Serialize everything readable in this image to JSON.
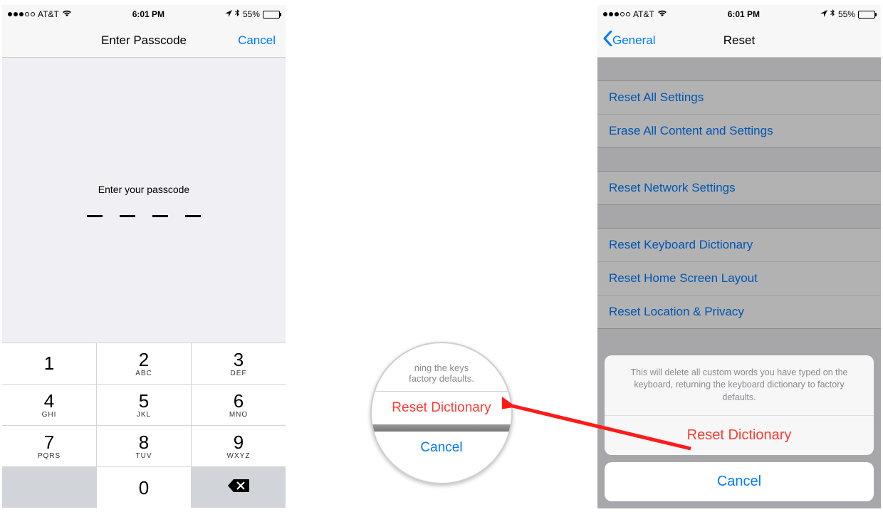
{
  "status_bar": {
    "carrier": "AT&T",
    "time": "6:01 PM",
    "battery_pct": "55%"
  },
  "passcode_screen": {
    "nav_title": "Enter Passcode",
    "nav_cancel": "Cancel",
    "prompt": "Enter your passcode",
    "keypad": [
      {
        "digit": "1",
        "letters": ""
      },
      {
        "digit": "2",
        "letters": "ABC"
      },
      {
        "digit": "3",
        "letters": "DEF"
      },
      {
        "digit": "4",
        "letters": "GHI"
      },
      {
        "digit": "5",
        "letters": "JKL"
      },
      {
        "digit": "6",
        "letters": "MNO"
      },
      {
        "digit": "7",
        "letters": "PQRS"
      },
      {
        "digit": "8",
        "letters": "TUV"
      },
      {
        "digit": "9",
        "letters": "WXYZ"
      },
      {
        "digit": "0",
        "letters": ""
      }
    ]
  },
  "reset_screen": {
    "nav_back": "General",
    "nav_title": "Reset",
    "items": [
      "Reset All Settings",
      "Erase All Content and Settings",
      "Reset Network Settings",
      "Reset Keyboard Dictionary",
      "Reset Home Screen Layout",
      "Reset Location & Privacy"
    ],
    "action_sheet": {
      "message": "This will delete all custom words you have typed on the keyboard, returning the keyboard dictionary to factory defaults.",
      "destructive": "Reset Dictionary",
      "cancel": "Cancel"
    }
  },
  "callout": {
    "hint_top": "ning the keys",
    "hint_bottom": "factory defaults.",
    "destructive": "Reset Dictionary",
    "cancel": "Cancel"
  }
}
